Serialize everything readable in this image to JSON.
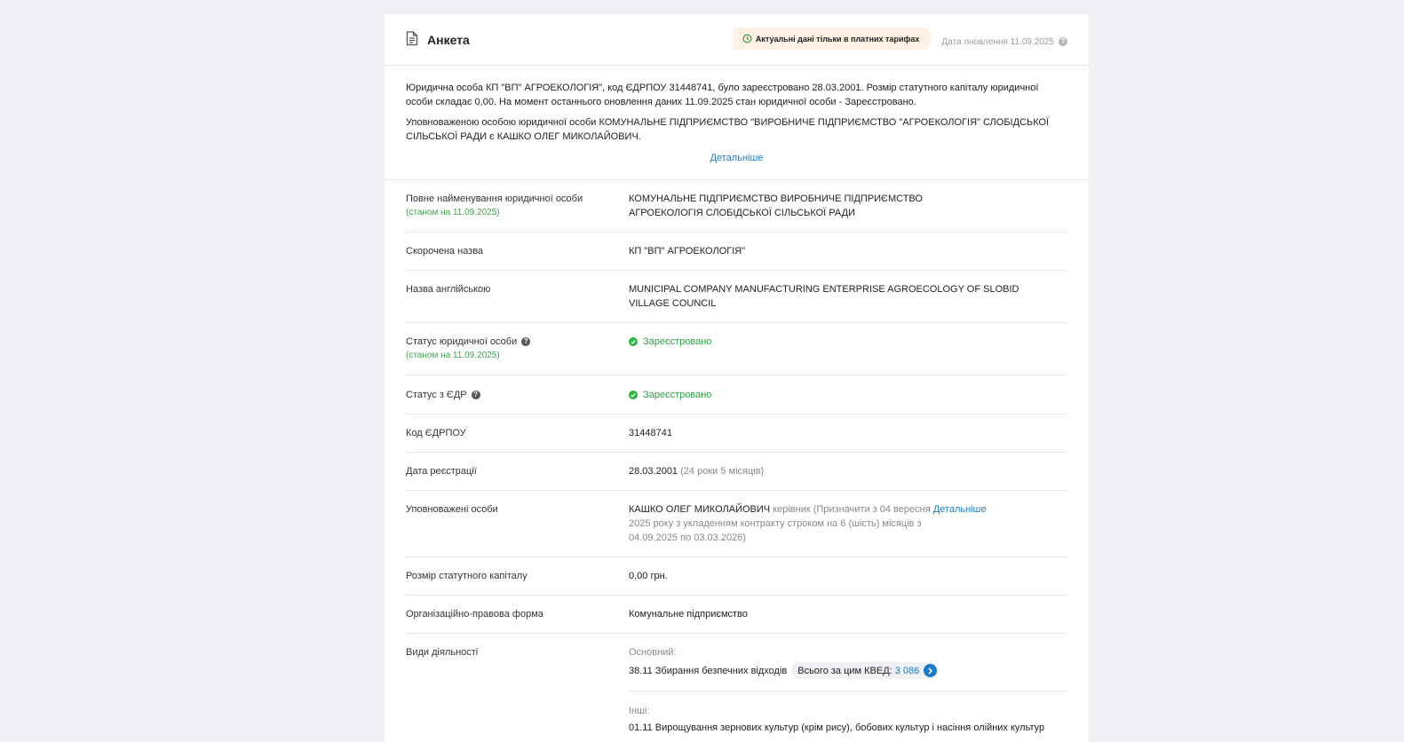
{
  "header": {
    "title": "Анкета",
    "tariff_badge": "Актуальні дані тільки в платних тарифах",
    "update_date": "Дата оновлення 11.09.2025",
    "icons": [
      "document-icon",
      "clock-icon",
      "help-icon"
    ]
  },
  "summary": {
    "paragraph1": "Юридична особа КП \"ВП\" АГРОЕКОЛОГІЯ\", код ЄДРПОУ 31448741, було зареєстровано 28.03.2001. Розмір статутного капіталу юридичної особи складає 0,00. На момент останнього оновлення даних 11.09.2025 стан юридичної особи - Зареєстровано.",
    "paragraph2": "Уповноваженою особою юридичної особи КОМУНАЛЬНЕ ПІДПРИЄМСТВО \"ВИРОБНИЧЕ ПІДПРИЄМСТВО \"АГРОЕКОЛОГІЯ\" СЛОБІДСЬКОЇ СІЛЬСЬКОЇ РАДИ є КАШКО ОЛЕГ МИКОЛАЙОВИЧ.",
    "more_link": "Детальніше"
  },
  "rows": {
    "full_name": {
      "label": "Повне найменування юридичної особи",
      "sub": "(станом на 11.09.2025)",
      "value": "КОМУНАЛЬНЕ ПІДПРИЄМСТВО ВИРОБНИЧЕ ПІДПРИЄМСТВО АГРОЕКОЛОГІЯ СЛОБІДСЬКОЇ СІЛЬСЬКОЇ РАДИ"
    },
    "short_name": {
      "label": "Скорочена назва",
      "value": "КП \"ВП\" АГРОЕКОЛОГІЯ\""
    },
    "english_name": {
      "label": "Назва англійською",
      "value": "MUNICIPAL COMPANY MANUFACTURING ENTERPRISE AGROECOLOGY OF SLOBID VILLAGE COUNCIL"
    },
    "status": {
      "label": "Статус юридичної особи",
      "sub": "(станом на 11.09.2025)",
      "value": "Зареєстровано"
    },
    "status_edr": {
      "label": "Статус з ЄДР",
      "value": "Зареєстровано"
    },
    "edrpou": {
      "label": "Код ЄДРПОУ",
      "value": "31448741"
    },
    "reg_date": {
      "label": "Дата реєстрації",
      "value": "28.03.2001",
      "age": "(24 роки 5 місяців)"
    },
    "authorized": {
      "label": "Уповноважені особи",
      "name": "КАШКО ОЛЕГ МИКОЛАЙОВИЧ",
      "role": "керівник (Призначити з 04 вересня",
      "link": "Детальніше",
      "rest": "2025 року з укладенням контракту строком на 6 (шість) місяців з 04.09.2025 по 03.03.2026)"
    },
    "capital": {
      "label": "Розмір статутного капіталу",
      "value": "0,00 грн."
    },
    "legal_form": {
      "label": "Організаційно-правова форма",
      "value": "Комунальне підприємство"
    },
    "activities": {
      "label": "Види діяльності",
      "main_label": "Основний:",
      "main_value": "38.11 Збирання безпечних відходів",
      "kved_label": "Всього за цим КВЕД:",
      "kved_count": "3 086",
      "other_label": "Інші:",
      "other_value": "01.11 Вирощування зернових культур (крім рису), бобових культур і насіння олійних культур"
    }
  }
}
